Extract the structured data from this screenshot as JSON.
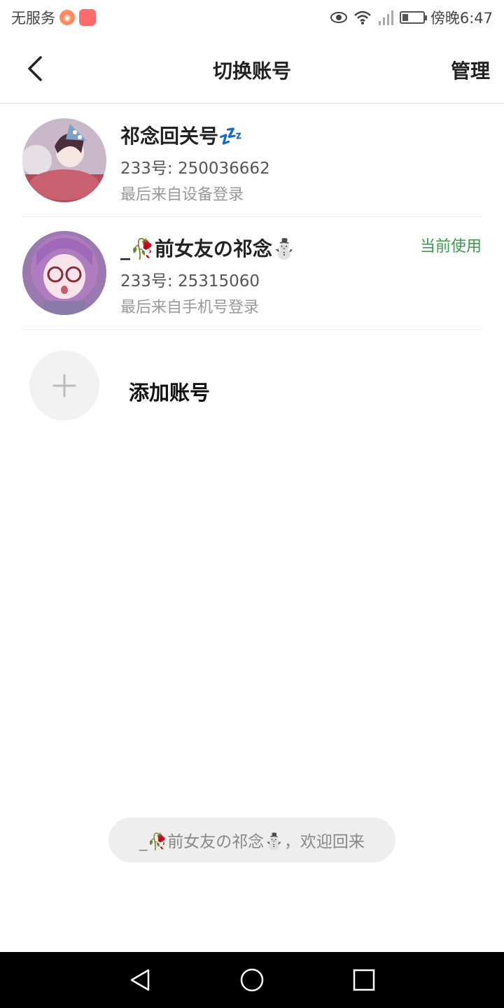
{
  "status_bar": {
    "carrier": "无服务",
    "time": "傍晚6:47",
    "battery_level": 0.3,
    "icons": [
      "app-badge-icon",
      "app-icon",
      "eye-icon",
      "wifi-icon",
      "signal-icon",
      "battery-icon"
    ]
  },
  "header": {
    "title": "切换账号",
    "manage_label": "管理",
    "back_icon": "chevron-left-icon"
  },
  "accounts": [
    {
      "name": "祁念回关号💤",
      "id_text": "233号: 250036662",
      "login_text": "最后来自设备登录",
      "current_label": ""
    },
    {
      "name": "_🥀前女友の祁念⛄",
      "id_text": "233号: 25315060",
      "login_text": "最后来自手机号登录",
      "current_label": "当前使用"
    }
  ],
  "add_account": {
    "label": "添加账号",
    "icon": "plus-icon"
  },
  "toast": {
    "text": "_🥀前女友の祁念⛄，欢迎回来"
  },
  "colors": {
    "accent_green": "#3a9c4a",
    "divider": "#ececec",
    "toast_bg": "#eeeeee"
  },
  "system_nav": {
    "icons": [
      "back-triangle-icon",
      "home-circle-icon",
      "recent-square-icon"
    ]
  }
}
